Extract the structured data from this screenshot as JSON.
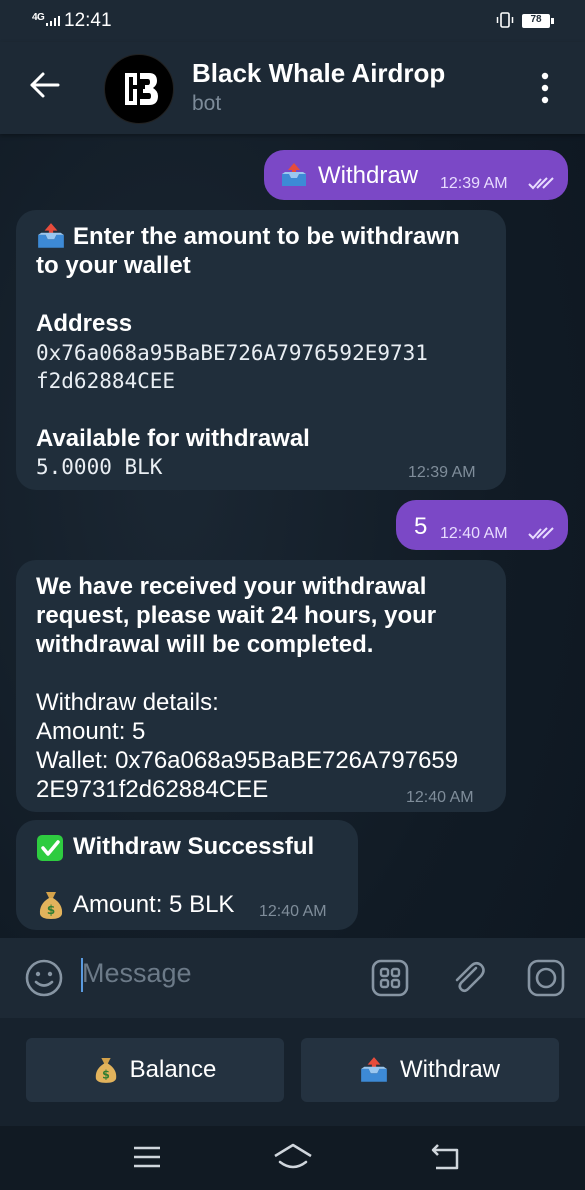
{
  "status_bar": {
    "network": "4G",
    "time": "12:41",
    "battery": "78"
  },
  "header": {
    "title": "Black Whale Airdrop",
    "subtitle": "bot"
  },
  "messages": [
    {
      "direction": "out",
      "icon": "outbox-tray",
      "text": "Withdraw",
      "time": "12:39 AM",
      "read": true
    },
    {
      "direction": "in",
      "icon": "outbox-tray",
      "line1": "Enter the amount to be withdrawn",
      "line2": "to your wallet",
      "address_label": "Address",
      "address_line1": "0x76a068a95BaBE726A7976592E9731",
      "address_line2": "f2d62884CEE",
      "available_label": "Available for withdrawal",
      "available_value": "5.0000 BLK",
      "time": "12:39 AM"
    },
    {
      "direction": "out",
      "text": "5",
      "time": "12:40 AM",
      "read": true
    },
    {
      "direction": "in",
      "line1": "We have received your withdrawal",
      "line2": "request, please wait 24 hours, your",
      "line3": "withdrawal will be completed.",
      "details_label": "Withdraw details:",
      "amount_line": "Amount: 5",
      "wallet_line1": "Wallet: 0x76a068a95BaBE726A797659",
      "wallet_line2": "2E9731f2d62884CEE",
      "time": "12:40 AM"
    },
    {
      "direction": "in",
      "success_icon": "check-mark-button",
      "success_text": "Withdraw Successful",
      "amount_icon": "money-bag",
      "amount_text": "Amount: 5 BLK",
      "time": "12:40 AM"
    }
  ],
  "input": {
    "placeholder": "Message"
  },
  "keyboard": {
    "buttons": [
      {
        "icon": "money-bag",
        "label": "Balance"
      },
      {
        "icon": "outbox-tray",
        "label": "Withdraw"
      }
    ]
  },
  "colors": {
    "outgoing_bubble": "#7b48c6",
    "incoming_bubble": "#202e3b",
    "header": "#1d2935"
  }
}
